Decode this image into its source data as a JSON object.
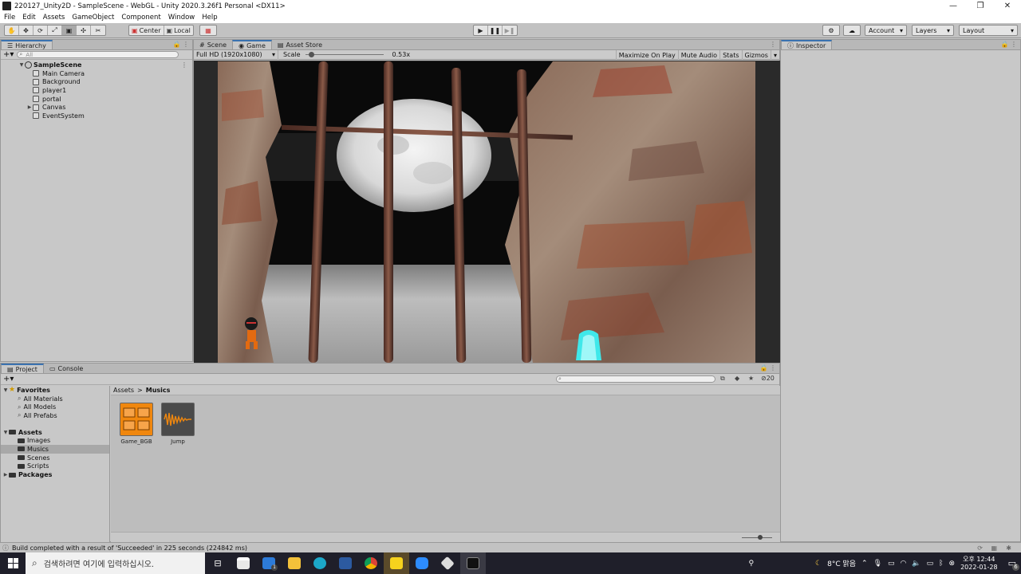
{
  "window": {
    "title": "220127_Unity2D - SampleScene - WebGL - Unity 2020.3.26f1 Personal <DX11>",
    "controls": [
      "—",
      "❐",
      "✕"
    ]
  },
  "menu": [
    "File",
    "Edit",
    "Assets",
    "GameObject",
    "Component",
    "Window",
    "Help"
  ],
  "toolbar": {
    "pivot_label": "Center",
    "space_label": "Local",
    "account_label": "Account",
    "layers_label": "Layers",
    "layout_label": "Layout"
  },
  "hierarchy": {
    "tab_label": "Hierarchy",
    "search_placeholder": "All",
    "scene_name": "SampleScene",
    "items": [
      "Main Camera",
      "Background",
      "player1",
      "portal",
      "Canvas",
      "EventSystem"
    ]
  },
  "center_tabs": [
    "Scene",
    "Game",
    "Asset Store"
  ],
  "game_bar": {
    "resolution": "Full HD (1920x1080)",
    "scale_label": "Scale",
    "scale_value": "0.53x",
    "scale_fraction": 0.05,
    "maximize": "Maximize On Play",
    "mute": "Mute Audio",
    "stats": "Stats",
    "gizmos": "Gizmos"
  },
  "inspector": {
    "tab_label": "Inspector"
  },
  "project": {
    "tabs": [
      "Project",
      "Console"
    ],
    "favorites_label": "Favorites",
    "favorites": [
      "All Materials",
      "All Models",
      "All Prefabs"
    ],
    "assets_label": "Assets",
    "asset_folders": [
      "Images",
      "Musics",
      "Scenes",
      "Scripts"
    ],
    "packages_label": "Packages",
    "breadcrumb_root": "Assets",
    "breadcrumb_sep": ">",
    "breadcrumb_current": "Musics",
    "hidden_count": "20",
    "files": [
      "Game_BGB",
      "Jump"
    ]
  },
  "status": {
    "message": "Build completed with a result of 'Succeeded' in 225 seconds (224842 ms)"
  },
  "taskbar": {
    "search_placeholder": "검색하려면 여기에 입력하십시오.",
    "weather": "8°C 맑음",
    "time": "오후 12:44",
    "date": "2022-01-28",
    "notifications": "6",
    "mail_badge": "1"
  },
  "colors": {
    "accent": "#3a72b0",
    "asset_orange": "#f0870e"
  }
}
